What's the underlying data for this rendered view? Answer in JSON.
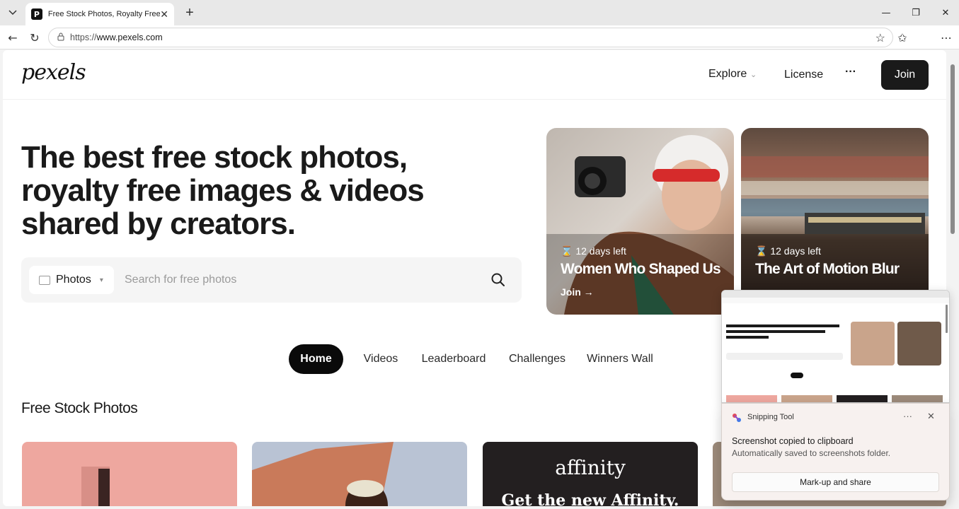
{
  "browser": {
    "tab_title": "Free Stock Photos, Royalty Free Stock",
    "url_prefix": "https://",
    "url_domain": "www.pexels.com",
    "icons": [
      "tab-list-icon",
      "close-icon",
      "plus-icon",
      "minimize-icon",
      "restore-icon",
      "close-window-icon",
      "back-icon",
      "reload-icon",
      "lock-icon",
      "star-icon",
      "favorites-icon",
      "more-icon"
    ]
  },
  "header": {
    "logo": "pexels",
    "explore": "Explore",
    "license": "License",
    "more": "···",
    "join": "Join"
  },
  "hero": {
    "title": "The best free stock photos, royalty free images & videos shared by creators."
  },
  "search": {
    "type_label": "Photos",
    "placeholder": "Search for free photos"
  },
  "challenges": [
    {
      "time_left": "12 days left",
      "title": "Women Who Shaped Us",
      "cta": "Join →"
    },
    {
      "time_left": "12 days left",
      "title": "The Art of Motion Blur",
      "cta": ""
    }
  ],
  "tabs": [
    "Home",
    "Videos",
    "Leaderboard",
    "Challenges",
    "Winners Wall"
  ],
  "active_tab": "Home",
  "section": {
    "title": "Free Stock Photos"
  },
  "ad": {
    "brand": "affinity",
    "tagline": "Get the new Affinity."
  },
  "toast": {
    "app": "Snipping Tool",
    "title": "Screenshot copied to clipboard",
    "subtitle": "Automatically saved to screenshots folder.",
    "button": "Mark-up and share"
  },
  "colors": {
    "primary_dark": "#1a1a1a",
    "page_bg": "#ffffff",
    "search_bg": "#f5f5f5"
  }
}
